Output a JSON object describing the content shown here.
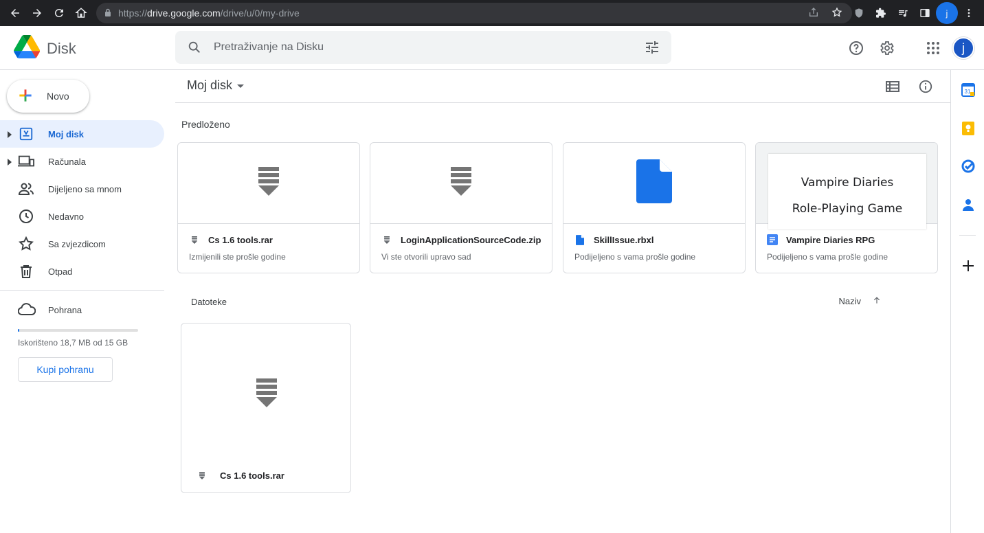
{
  "browser": {
    "url_prefix": "https://",
    "url_host": "drive.google.com",
    "url_path": "/drive/u/0/my-drive",
    "profile_initial": "j"
  },
  "app": {
    "name": "Disk",
    "search_placeholder": "Pretraživanje na Disku",
    "avatar_initial": "j"
  },
  "sidebar": {
    "new_label": "Novo",
    "items": [
      {
        "label": "Moj disk",
        "icon": "drive-icon",
        "active": true,
        "expandable": true
      },
      {
        "label": "Računala",
        "icon": "computers-icon",
        "active": false,
        "expandable": true
      },
      {
        "label": "Dijeljeno sa mnom",
        "icon": "shared-icon",
        "active": false,
        "expandable": false
      },
      {
        "label": "Nedavno",
        "icon": "clock-icon",
        "active": false,
        "expandable": false
      },
      {
        "label": "Sa zvjezdicom",
        "icon": "star-icon",
        "active": false,
        "expandable": false
      },
      {
        "label": "Otpad",
        "icon": "trash-icon",
        "active": false,
        "expandable": false
      }
    ],
    "storage_label": "Pohrana",
    "storage_used_text": "Iskorišteno 18,7 MB od 15 GB",
    "storage_fraction": 0.0012,
    "buy_label": "Kupi pohranu"
  },
  "main": {
    "title": "Moj disk",
    "suggested_title": "Predloženo",
    "suggested": [
      {
        "name": "Cs 1.6 tools.rar",
        "meta": "Izmijenili ste prošle godine",
        "type": "archive"
      },
      {
        "name": "LoginApplicationSourceCode.zip",
        "meta": "Vi ste otvorili upravo sad",
        "type": "archive"
      },
      {
        "name": "SkillIssue.rbxl",
        "meta": "Podijeljeno s vama prošle godine",
        "type": "file"
      },
      {
        "name": "Vampire Diaries RPG",
        "meta": "Podijeljeno s vama prošle godine",
        "type": "doc",
        "preview_line1": "Vampire Diaries",
        "preview_line2": "Role-Playing Game"
      }
    ],
    "files_title": "Datoteke",
    "sort_label": "Naziv",
    "files": [
      {
        "name": "Cs 1.6 tools.rar",
        "type": "archive"
      }
    ]
  },
  "colors": {
    "accent": "#1a73e8",
    "active_bg": "#e8f0fe",
    "active_text": "#1967d2"
  }
}
